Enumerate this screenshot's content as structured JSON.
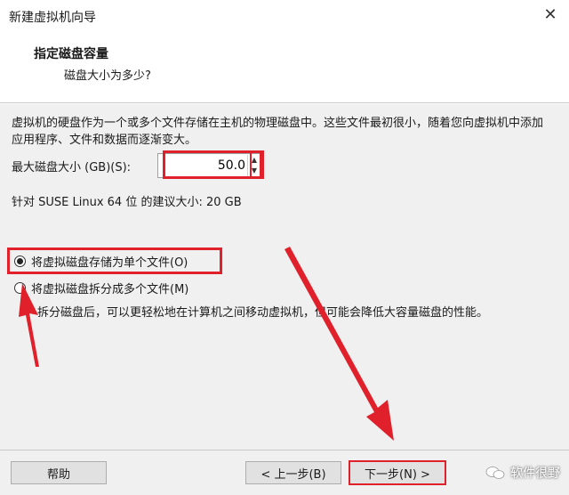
{
  "window": {
    "title": "新建虚拟机向导",
    "close_glyph": "✕"
  },
  "header": {
    "title": "指定磁盘容量",
    "subtitle": "磁盘大小为多少?"
  },
  "body": {
    "description": "虚拟机的硬盘作为一个或多个文件存储在主机的物理磁盘中。这些文件最初很小，随着您向虚拟机中添加应用程序、文件和数据而逐渐变大。",
    "max_size_label": "最大磁盘大小 (GB)(S):",
    "max_size_value": "50.0",
    "recommendation": "针对 SUSE Linux 64 位 的建议大小: 20 GB",
    "options": [
      {
        "label": "将虚拟磁盘存储为单个文件(O)",
        "checked": true
      },
      {
        "label": "将虚拟磁盘拆分成多个文件(M)",
        "checked": false
      }
    ],
    "split_description": "拆分磁盘后，可以更轻松地在计算机之间移动虚拟机，但可能会降低大容量磁盘的性能。"
  },
  "footer": {
    "help_label": "帮助",
    "back_label": "< 上一步(B)",
    "next_label": "下一步(N) >",
    "watermark": "软件很野"
  },
  "colors": {
    "highlight": "#e0202a",
    "body_bg": "#f0f0f0"
  }
}
